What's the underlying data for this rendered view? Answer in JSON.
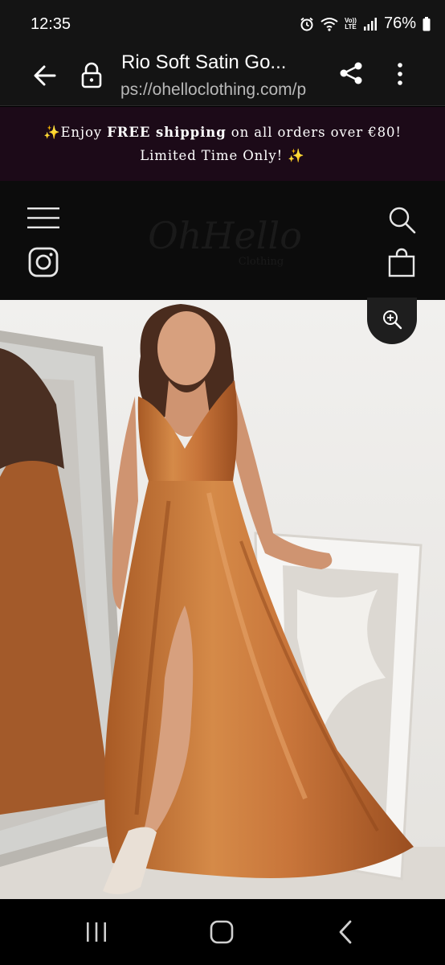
{
  "status": {
    "time": "12:35",
    "battery": "76%",
    "volte_top": "Vo))",
    "volte_bottom": "LTE"
  },
  "browser": {
    "title": "Rio Soft Satin Go...",
    "url": "ps://ohelloclothing.com/p"
  },
  "promo": {
    "prefix": "✨Enjoy ",
    "free": "FREE shipping",
    "rest": " on all orders over €80!",
    "line2": "Limited Time Only! ✨"
  },
  "header": {
    "logo_script": "OhHello",
    "logo_sub": "Clothing"
  },
  "product_image": {
    "alt": "Woman wearing a burnt orange satin wrap maxi dress with a thigh-high slit, standing beside a mirror"
  },
  "colors": {
    "promo_bg": "#1c0a18",
    "dress": "#c8753a",
    "header_bg": "#0c0c0c"
  },
  "icons": [
    "back-arrow-icon",
    "lock-icon",
    "share-icon",
    "more-vert-icon",
    "hamburger-icon",
    "instagram-icon",
    "search-icon",
    "shopping-bag-icon",
    "zoom-in-icon",
    "recent-apps-icon",
    "home-icon",
    "nav-back-icon"
  ]
}
